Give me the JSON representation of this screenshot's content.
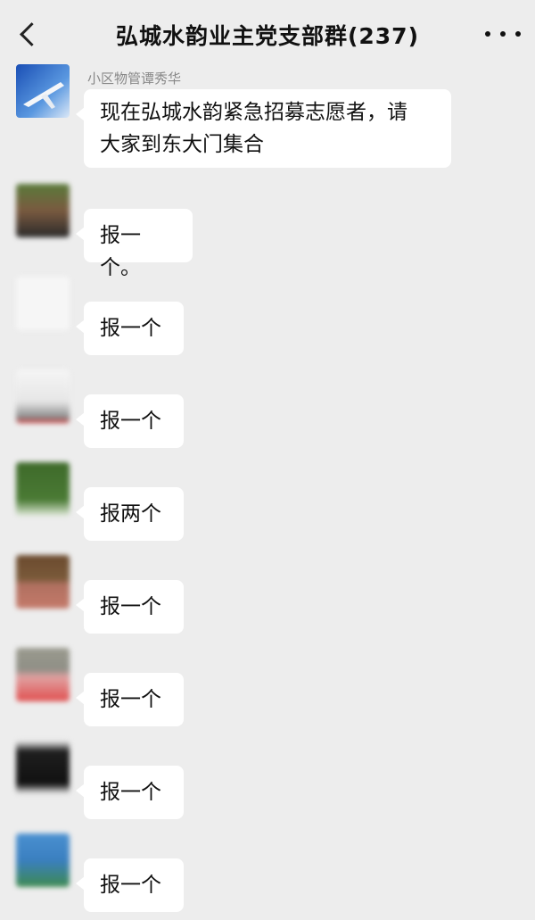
{
  "header": {
    "title": "弘城水韵业主党支部群(237)"
  },
  "messages": [
    {
      "sender": "小区物管谭秀华",
      "text": "现在弘城水韵紧急招募志愿者，请\n大家到东大门集合",
      "avatar_icon": "sky-airplane-avatar"
    },
    {
      "sender": "",
      "text": "报一个。",
      "avatar_icon": "blurred-avatar"
    },
    {
      "sender": "",
      "text": "报一个",
      "avatar_icon": "blurred-avatar"
    },
    {
      "sender": "",
      "text": "报一个",
      "avatar_icon": "blurred-avatar"
    },
    {
      "sender": "",
      "text": "报两个",
      "avatar_icon": "blurred-avatar"
    },
    {
      "sender": "",
      "text": "报一个",
      "avatar_icon": "blurred-avatar"
    },
    {
      "sender": "",
      "text": "报一个",
      "avatar_icon": "blurred-avatar"
    },
    {
      "sender": "",
      "text": "报一个",
      "avatar_icon": "blurred-avatar"
    },
    {
      "sender": "",
      "text": "报一个",
      "avatar_icon": "blurred-avatar"
    }
  ]
}
